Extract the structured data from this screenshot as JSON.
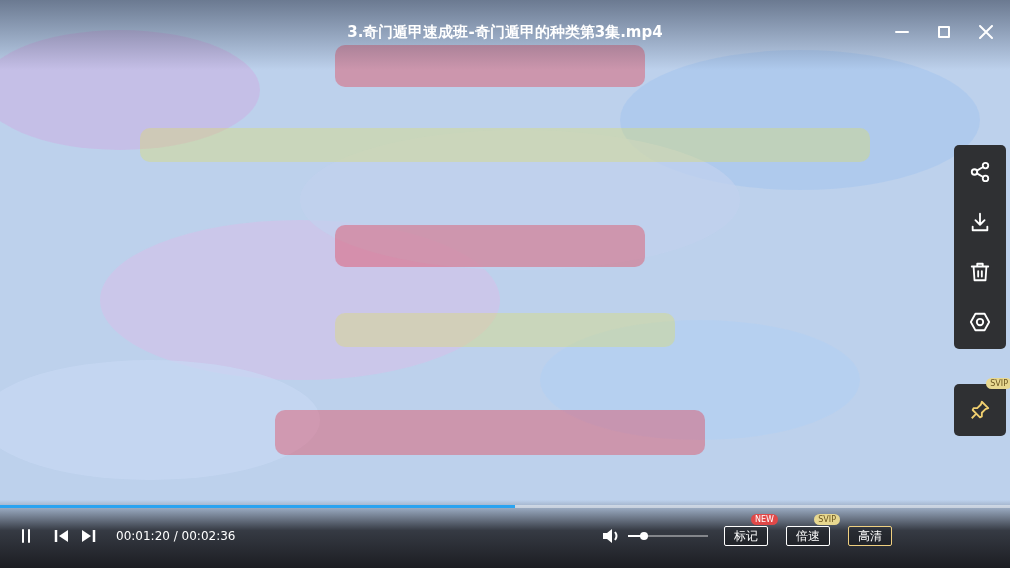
{
  "window": {
    "title": "3.奇门遁甲速成班-奇门遁甲的种类第3集.mp4"
  },
  "side_panel": {
    "actions": [
      {
        "kind": "share"
      },
      {
        "kind": "download"
      },
      {
        "kind": "delete"
      },
      {
        "kind": "settings"
      }
    ],
    "pin": {
      "badge": "SVIP"
    }
  },
  "player": {
    "progress": {
      "level": 0.51
    },
    "playing": true,
    "time": "00:01:20 / 00:02:36",
    "volume": {
      "level": 0.2
    },
    "buttons": [
      {
        "label": "标记",
        "badge": "NEW",
        "color": "#e04848",
        "highlighted": false
      },
      {
        "label": "倍速",
        "badge": "SVIP",
        "color": "#e8d890",
        "highlighted": false
      },
      {
        "label": "高清",
        "highlighted": true
      }
    ]
  }
}
